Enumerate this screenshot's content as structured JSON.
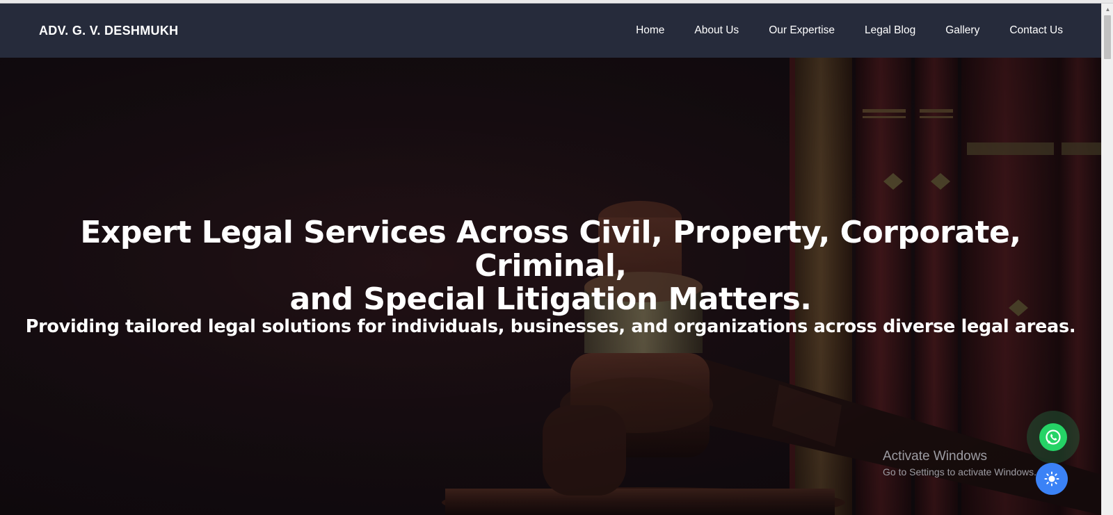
{
  "header": {
    "brand": "ADV. G. V. DESHMUKH",
    "nav": [
      {
        "label": "Home"
      },
      {
        "label": "About Us"
      },
      {
        "label": "Our Expertise"
      },
      {
        "label": "Legal Blog"
      },
      {
        "label": "Gallery"
      },
      {
        "label": "Contact Us"
      }
    ]
  },
  "hero": {
    "title_line1": "Expert Legal Services Across Civil, Property, Corporate, Criminal,",
    "title_line2": "and Special Litigation Matters.",
    "subtitle": "Providing tailored legal solutions for individuals, businesses, and organizations across diverse legal areas."
  },
  "watermark": {
    "title": "Activate Windows",
    "subtitle": "Go to Settings to activate Windows."
  },
  "floating": {
    "whatsapp_icon": "whatsapp-icon",
    "theme_icon": "sun-icon"
  },
  "colors": {
    "navbar": "#262b3b",
    "whatsapp": "#25d366",
    "theme_button": "#3b82f6"
  }
}
